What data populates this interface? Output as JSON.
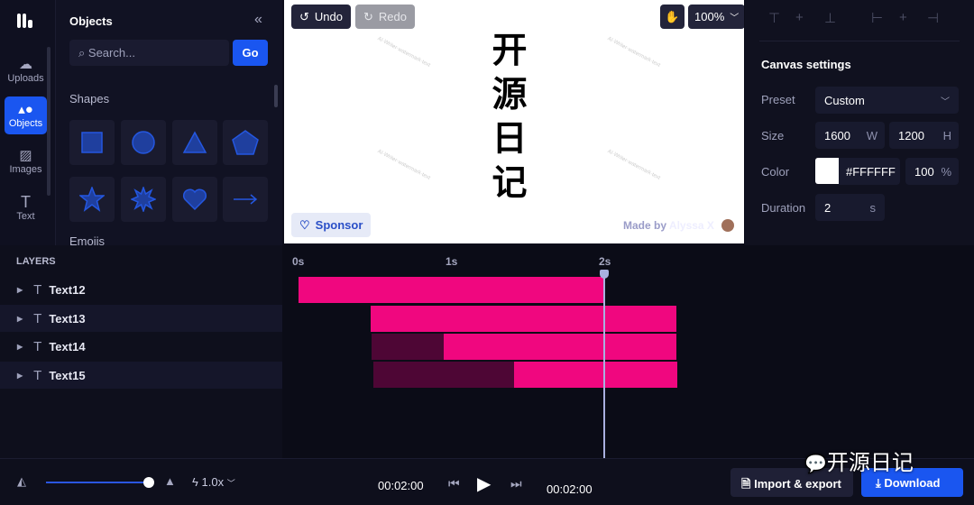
{
  "rail": {
    "items": [
      {
        "label": "Uploads",
        "icon": "cloud-upload-icon"
      },
      {
        "label": "Objects",
        "icon": "shapes-icon",
        "active": true
      },
      {
        "label": "Images",
        "icon": "image-icon"
      },
      {
        "label": "Text",
        "icon": "text-icon"
      }
    ]
  },
  "panel": {
    "title": "Objects",
    "search_placeholder": "Search...",
    "go": "Go",
    "shapes_label": "Shapes",
    "emojis_label": "Emojis",
    "shapes": [
      "square",
      "circle",
      "triangle",
      "pentagon",
      "star",
      "starburst",
      "heart",
      "arrow"
    ],
    "shape_color": "#1f4fd8"
  },
  "canvas": {
    "undo": "Undo",
    "redo": "Redo",
    "zoom": "100%",
    "text": [
      "开",
      "源",
      "日",
      "记"
    ],
    "sponsor": "Sponsor",
    "made_by": "Made by",
    "author": "Alyssa X"
  },
  "settings": {
    "title": "Canvas settings",
    "preset_label": "Preset",
    "preset": "Custom",
    "size_label": "Size",
    "width": "1600",
    "width_unit": "W",
    "height": "1200",
    "height_unit": "H",
    "color_label": "Color",
    "color": "#FFFFFF",
    "opacity": "100",
    "opacity_unit": "%",
    "duration_label": "Duration",
    "duration": "2",
    "duration_unit": "s"
  },
  "layers": {
    "title": "LAYERS",
    "items": [
      "Text12",
      "Text13",
      "Text14",
      "Text15"
    ]
  },
  "timeline": {
    "ticks": [
      "0s",
      "1s",
      "2s"
    ],
    "playhead_s": 2,
    "tracks": [
      {
        "start": 0,
        "end": 2,
        "fill_start": 0
      },
      {
        "start": 0.47,
        "end": 2.47,
        "fill_start": 0.47
      },
      {
        "start": 0.48,
        "end": 2.47,
        "fill_start": 0.95
      },
      {
        "start": 0.49,
        "end": 2.48,
        "fill_start": 1.41
      }
    ],
    "bar_color": "#f0077f"
  },
  "bottom": {
    "speed": "1.0x",
    "current_time": "00:02:00",
    "total_time": "00:02:00",
    "zoom_level": 1.0,
    "import_export": "Import & export",
    "download": "Download",
    "watermark": "开源日记"
  }
}
